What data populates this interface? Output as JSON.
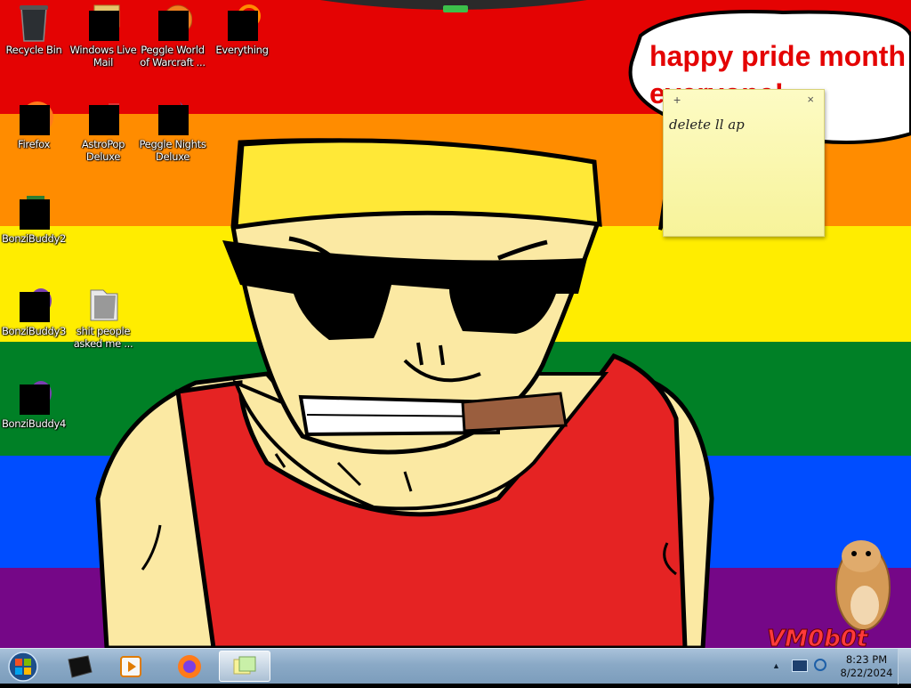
{
  "desktop": {
    "icons": [
      {
        "label": "Recycle Bin",
        "icon": "recycle-bin-icon"
      },
      {
        "label": "Windows Live Mail",
        "icon": "windows-live-mail-icon"
      },
      {
        "label": "Peggle World of Warcraft ...",
        "icon": "peggle-wow-icon"
      },
      {
        "label": "Everything",
        "icon": "everything-search-icon"
      },
      {
        "label": "Firefox",
        "icon": "firefox-icon"
      },
      {
        "label": "AstroPop Deluxe",
        "icon": "astropop-icon"
      },
      {
        "label": "Peggle Nights Deluxe",
        "icon": "peggle-nights-icon"
      },
      {
        "label": "BonziBuddy2",
        "icon": "bonzibuddy-icon"
      },
      {
        "label": "BonziBuddy3",
        "icon": "bonzibuddy-icon"
      },
      {
        "label": "shit people asked me ...",
        "icon": "folder-icon"
      },
      {
        "label": "BonziBuddy4",
        "icon": "bonzibuddy-icon"
      }
    ],
    "wallpaper": {
      "speech_text_line1": "happy pride month",
      "speech_text_line2": "everyone!",
      "watermark": "VM0b0t",
      "stripe_colors": [
        "#e40303",
        "#ff8c00",
        "#ffed00",
        "#008026",
        "#004dff",
        "#750787"
      ]
    }
  },
  "sticky_note": {
    "add_symbol": "+",
    "close_symbol": "×",
    "text": "delete ll ap"
  },
  "taskbar": {
    "start_icon": "windows-orb-icon",
    "pinned": [
      {
        "icon": "terminal-icon"
      },
      {
        "icon": "media-player-icon"
      },
      {
        "icon": "firefox-icon"
      },
      {
        "icon": "sticky-notes-icon",
        "active": true
      }
    ],
    "tray": {
      "clock_time": "8:23 PM",
      "clock_date": "8/22/2024"
    }
  }
}
